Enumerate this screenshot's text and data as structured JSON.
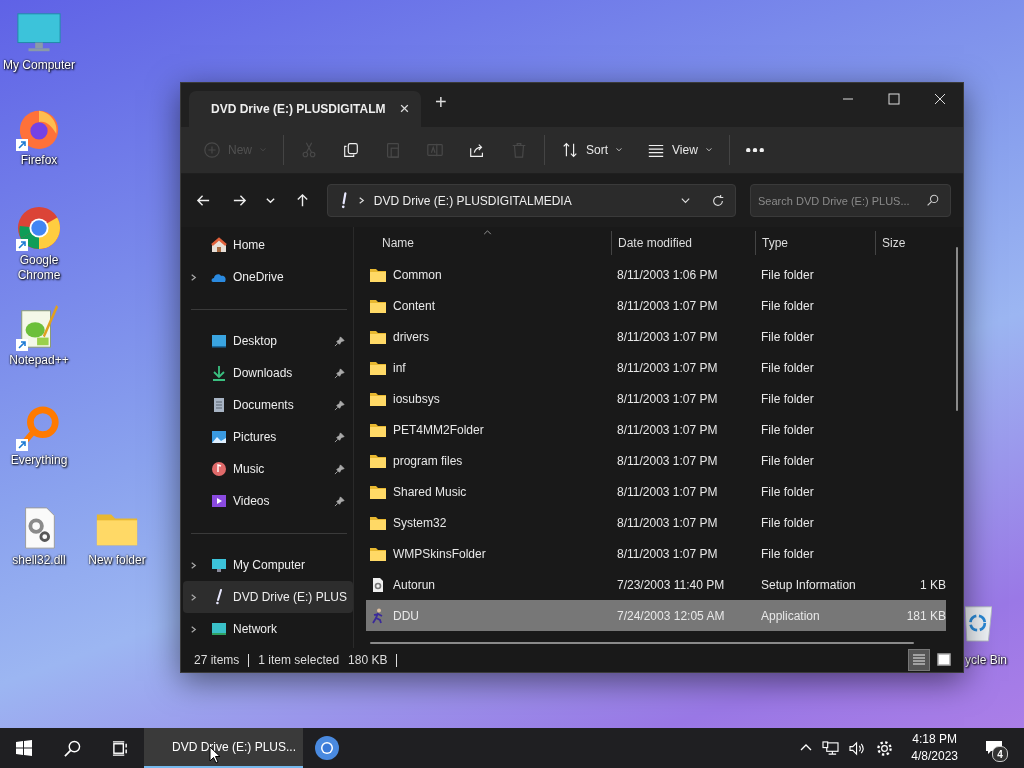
{
  "desktop_icons": [
    {
      "label": "My Computer",
      "kind": "computer",
      "shortcut": false
    },
    {
      "label": "Firefox",
      "kind": "firefox",
      "shortcut": true
    },
    {
      "label": "Google Chrome",
      "kind": "chrome",
      "shortcut": true
    },
    {
      "label": "Notepad++",
      "kind": "notepad",
      "shortcut": true
    },
    {
      "label": "Everything",
      "kind": "everything",
      "shortcut": true
    },
    {
      "label": "shell32.dll",
      "kind": "dll",
      "shortcut": false
    },
    {
      "label": "New folder",
      "kind": "folder",
      "shortcut": false
    },
    {
      "label": "ycle Bin",
      "kind": "recycle",
      "shortcut": false
    }
  ],
  "window": {
    "tab": {
      "title": "DVD Drive (E:) PLUSDIGITALM",
      "close": "×"
    },
    "new_tab": "+",
    "toolbar": [
      {
        "kind": "new",
        "label": "New",
        "disabled": true
      },
      {
        "kind": "cut",
        "disabled": true
      },
      {
        "kind": "copy",
        "disabled": false
      },
      {
        "kind": "paste",
        "disabled": true
      },
      {
        "kind": "rename",
        "disabled": true
      },
      {
        "kind": "share",
        "disabled": false
      },
      {
        "kind": "delete",
        "disabled": true
      },
      {
        "kind": "sort",
        "label": "Sort",
        "disabled": false
      },
      {
        "kind": "view",
        "label": "View",
        "disabled": false
      },
      {
        "kind": "more",
        "disabled": false
      }
    ],
    "address": "DVD Drive (E:) PLUSDIGITALMEDIA",
    "search": {
      "placeholder": "Search DVD Drive (E:) PLUS..."
    },
    "sidebar": {
      "groups": [
        [
          {
            "label": "Home",
            "kind": "home",
            "expandable": false,
            "pinned": false,
            "selected": false
          },
          {
            "label": "OneDrive",
            "kind": "onedrive",
            "expandable": true,
            "pinned": false,
            "selected": false
          }
        ],
        [
          {
            "label": "Desktop",
            "kind": "desktop",
            "expandable": false,
            "pinned": true,
            "selected": false
          },
          {
            "label": "Downloads",
            "kind": "downloads",
            "expandable": false,
            "pinned": true,
            "selected": false
          },
          {
            "label": "Documents",
            "kind": "documents",
            "expandable": false,
            "pinned": true,
            "selected": false
          },
          {
            "label": "Pictures",
            "kind": "pictures",
            "expandable": false,
            "pinned": true,
            "selected": false
          },
          {
            "label": "Music",
            "kind": "music",
            "expandable": false,
            "pinned": true,
            "selected": false
          },
          {
            "label": "Videos",
            "kind": "videos",
            "expandable": false,
            "pinned": true,
            "selected": false
          }
        ],
        [
          {
            "label": "My Computer",
            "kind": "computer",
            "expandable": true,
            "pinned": false,
            "selected": false
          },
          {
            "label": "DVD Drive (E:) PLUS",
            "kind": "dvd",
            "expandable": true,
            "pinned": false,
            "selected": true
          },
          {
            "label": "Network",
            "kind": "network",
            "expandable": true,
            "pinned": false,
            "selected": false
          }
        ]
      ]
    },
    "table": {
      "columns": [
        "Name",
        "Date modified",
        "Type",
        "Size"
      ],
      "rows": [
        {
          "name": "Common",
          "date": "8/11/2003 1:06 PM",
          "type": "File folder",
          "size": "",
          "kind": "folder",
          "selected": false
        },
        {
          "name": "Content",
          "date": "8/11/2003 1:07 PM",
          "type": "File folder",
          "size": "",
          "kind": "folder",
          "selected": false
        },
        {
          "name": "drivers",
          "date": "8/11/2003 1:07 PM",
          "type": "File folder",
          "size": "",
          "kind": "folder",
          "selected": false
        },
        {
          "name": "inf",
          "date": "8/11/2003 1:07 PM",
          "type": "File folder",
          "size": "",
          "kind": "folder",
          "selected": false
        },
        {
          "name": "iosubsys",
          "date": "8/11/2003 1:07 PM",
          "type": "File folder",
          "size": "",
          "kind": "folder",
          "selected": false
        },
        {
          "name": "PET4MM2Folder",
          "date": "8/11/2003 1:07 PM",
          "type": "File folder",
          "size": "",
          "kind": "folder",
          "selected": false
        },
        {
          "name": "program files",
          "date": "8/11/2003 1:07 PM",
          "type": "File folder",
          "size": "",
          "kind": "folder",
          "selected": false
        },
        {
          "name": "Shared Music",
          "date": "8/11/2003 1:07 PM",
          "type": "File folder",
          "size": "",
          "kind": "folder",
          "selected": false
        },
        {
          "name": "System32",
          "date": "8/11/2003 1:07 PM",
          "type": "File folder",
          "size": "",
          "kind": "folder",
          "selected": false
        },
        {
          "name": "WMPSkinsFolder",
          "date": "8/11/2003 1:07 PM",
          "type": "File folder",
          "size": "",
          "kind": "folder",
          "selected": false
        },
        {
          "name": "Autorun",
          "date": "7/23/2003 11:40 PM",
          "type": "Setup Information",
          "size": "1 KB",
          "kind": "setup",
          "selected": false
        },
        {
          "name": "DDU",
          "date": "7/24/2003 12:05 AM",
          "type": "Application",
          "size": "181 KB",
          "kind": "app",
          "selected": true
        }
      ]
    },
    "status_bar": {
      "count": "27 items",
      "selection": "1 item selected",
      "selection_size": "180 KB",
      "views": [
        {
          "kind": "details",
          "selected": true
        },
        {
          "kind": "tiles",
          "selected": false
        }
      ]
    }
  },
  "taskbar": {
    "app": "DVD Drive (E:) PLUS...",
    "time": "4:18 PM",
    "date": "4/8/2023",
    "notifications": "4"
  }
}
